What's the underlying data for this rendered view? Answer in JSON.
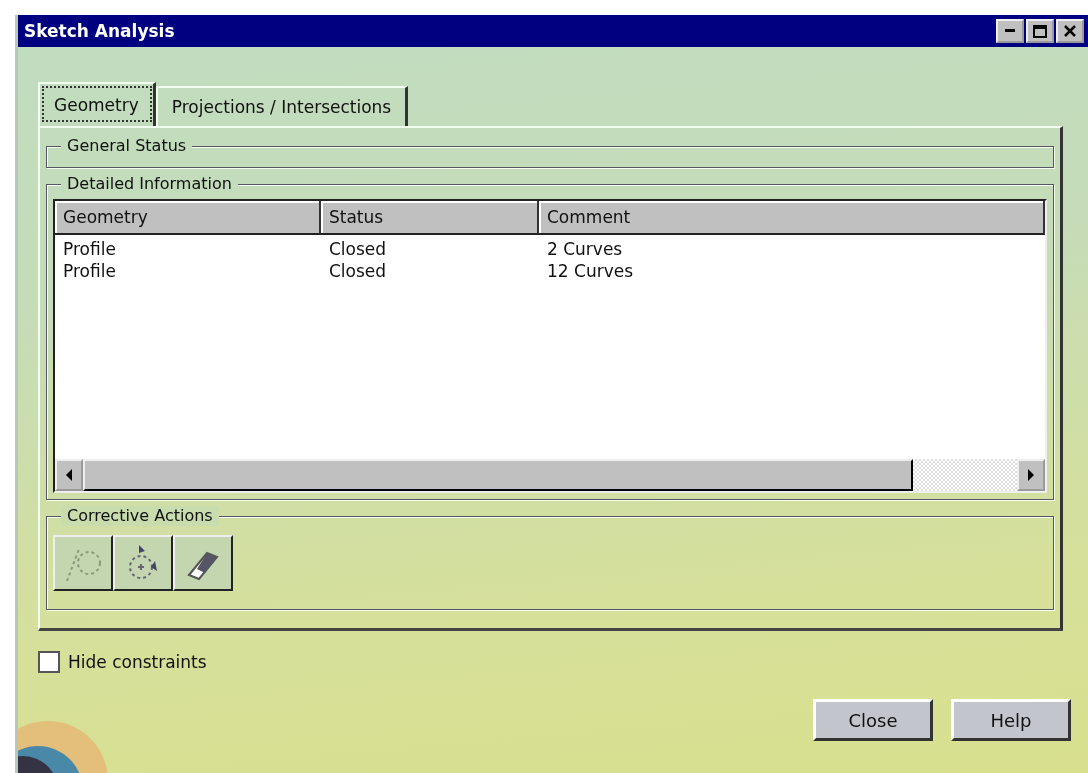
{
  "window": {
    "title": "Sketch Analysis"
  },
  "tabs": [
    {
      "label": "Geometry",
      "selected": true
    },
    {
      "label": "Projections / Intersections",
      "selected": false
    }
  ],
  "general_status": {
    "title": "General Status"
  },
  "detailed_information": {
    "title": "Detailed Information",
    "columns": [
      "Geometry",
      "Status",
      "Comment"
    ],
    "rows": [
      [
        "Profile",
        "Closed",
        "2 Curves"
      ],
      [
        "Profile",
        "Closed",
        "12 Curves"
      ]
    ]
  },
  "corrective_actions": {
    "title": "Corrective Actions"
  },
  "hide_constraints": {
    "label": "Hide constraints",
    "checked": false
  },
  "buttons": [
    "Close",
    "Help"
  ]
}
